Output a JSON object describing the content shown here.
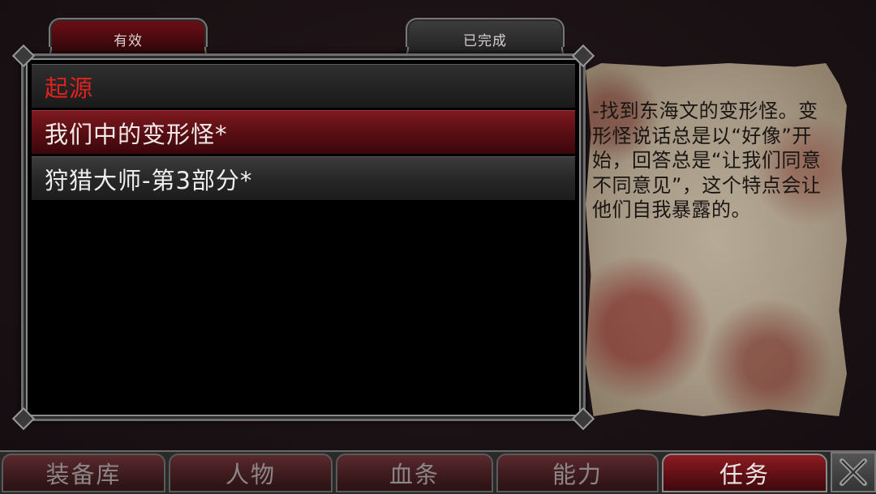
{
  "tabs": {
    "active_label": "有效",
    "completed_label": "已完成"
  },
  "quests": {
    "header": "起源",
    "items": [
      {
        "label": "我们中的变形怪*",
        "selected": true
      },
      {
        "label": "狩猎大师-第3部分*",
        "selected": false
      }
    ]
  },
  "description": "-找到东海文的变形怪。变形怪说话总是以“好像”开始，回答总是“让我们同意不同意见”，这个特点会让他们自我暴露的。",
  "nav": {
    "items": [
      {
        "label": "装备库"
      },
      {
        "label": "人物"
      },
      {
        "label": "血条"
      },
      {
        "label": "能力"
      },
      {
        "label": "任务",
        "active": true
      }
    ],
    "close_icon": "close-x-icon"
  },
  "colors": {
    "accent_red": "#e0211f",
    "selected_row": "#7d1a20",
    "parchment": "#a59884"
  }
}
